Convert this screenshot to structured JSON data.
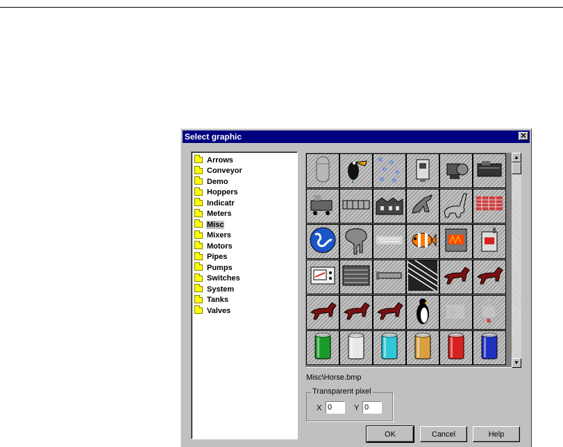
{
  "dialog": {
    "title": "Select graphic",
    "close_glyph": "✕"
  },
  "folders": [
    "Arrows",
    "Conveyor",
    "Demo",
    "Hoppers",
    "Indicatr",
    "Meters",
    "Misc",
    "Mixers",
    "Motors",
    "Pipes",
    "Pumps",
    "Switches",
    "System",
    "Tanks",
    "Valves"
  ],
  "selected_folder": "Misc",
  "graphics_grid": {
    "rows": 6,
    "cols": 6,
    "icons": [
      "silo-icon",
      "toucan-icon",
      "bubbles-icon",
      "camera-icon",
      "pump-motor-icon",
      "generator-icon",
      "machine-icon",
      "conveyor-belt-icon",
      "factory-building-icon",
      "dinosaur-icon",
      "brontosaurus-icon",
      "brick-pattern-icon",
      "globe-icon",
      "elephant-icon",
      "faded-banner-icon",
      "clownfish-icon",
      "furnace-icon",
      "boiler-icon",
      "control-panel-icon",
      "filter-press-icon",
      "pipe-section-icon",
      "stripes-icon",
      "horse-icon",
      "horse-icon",
      "horse-icon",
      "horse-icon",
      "horse-icon",
      "penguin-icon",
      "faded-machine-icon",
      "faded-valve-icon",
      "green-cylinder-icon",
      "white-cylinder-icon",
      "cyan-cylinder-icon",
      "orange-cylinder-icon",
      "red-cylinder-icon",
      "blue-cylinder-icon"
    ],
    "cylinder_colors": [
      "#1a9a2a",
      "#e8e8e8",
      "#2ec8d8",
      "#d8a040",
      "#d82020",
      "#2030c0"
    ]
  },
  "scrollbar": {
    "up_glyph": "▲",
    "down_glyph": "▼"
  },
  "file_path": "Misc\\Horse.bmp",
  "transparent_pixel": {
    "group_label": "Transparent pixel",
    "x_label": "X",
    "x_value": "0",
    "y_label": "Y",
    "y_value": "0"
  },
  "buttons": {
    "ok": "OK",
    "cancel": "Cancel",
    "help": "Help"
  }
}
